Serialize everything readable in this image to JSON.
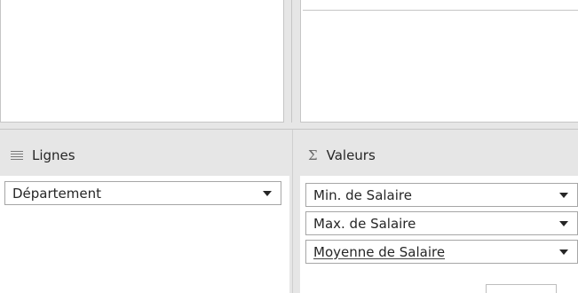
{
  "rows_area": {
    "title": "Lignes",
    "icon": "list-lines-icon",
    "fields": [
      {
        "label": "Département"
      }
    ]
  },
  "values_area": {
    "title": "Valeurs",
    "icon_glyph": "Σ",
    "fields": [
      {
        "label": "Min. de Salaire"
      },
      {
        "label": "Max. de Salaire"
      },
      {
        "label": "Moyenne de Salaire"
      }
    ]
  },
  "colors": {
    "background": "#e6e6e6",
    "pane": "#ffffff",
    "border": "#a6a6a6",
    "text": "#262626"
  }
}
